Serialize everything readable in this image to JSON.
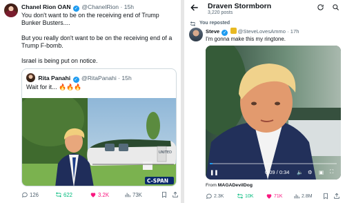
{
  "left_post": {
    "author_name": "Chanel Rion OAN",
    "author_handle": "@ChanelRion",
    "time": "15h",
    "text_line1": "You don't want to be on the receiving end of Trump Bunker Busters....",
    "text_line2": "But you really don't want to be on the receiving end of a Trump F-bomb.",
    "text_line3": "Israel is being put on notice.",
    "quote": {
      "author_name": "Rita Panahi",
      "author_handle": "@RitaPanahi",
      "time": "15h",
      "text": "Wait for it... 🔥🔥🔥",
      "network_logo": "C-SPAN",
      "aircraft_text": "UNITED"
    },
    "stats": {
      "replies": "126",
      "reposts": "622",
      "likes": "3.2K",
      "views": "73K"
    }
  },
  "right_panel": {
    "title": "Draven Stormborn",
    "subtitle": "3,220 posts",
    "reposted_label": "You reposted",
    "post": {
      "author_name": "Steve",
      "author_handle": "@SteveLovesAmmo",
      "time": "17h",
      "text": "I'm gonna make this my ringtone.",
      "video_time": "0:09 / 0:34",
      "from_label": "From",
      "from_account": "MAGADevilDog",
      "stats": {
        "replies": "2.3K",
        "reposts": "10K",
        "likes": "71K",
        "views": "2.8M"
      }
    }
  },
  "colors": {
    "accent": "#1d9bf0",
    "muted": "#536471",
    "repost_green": "#00ba7c",
    "like_pink": "#f91880"
  }
}
